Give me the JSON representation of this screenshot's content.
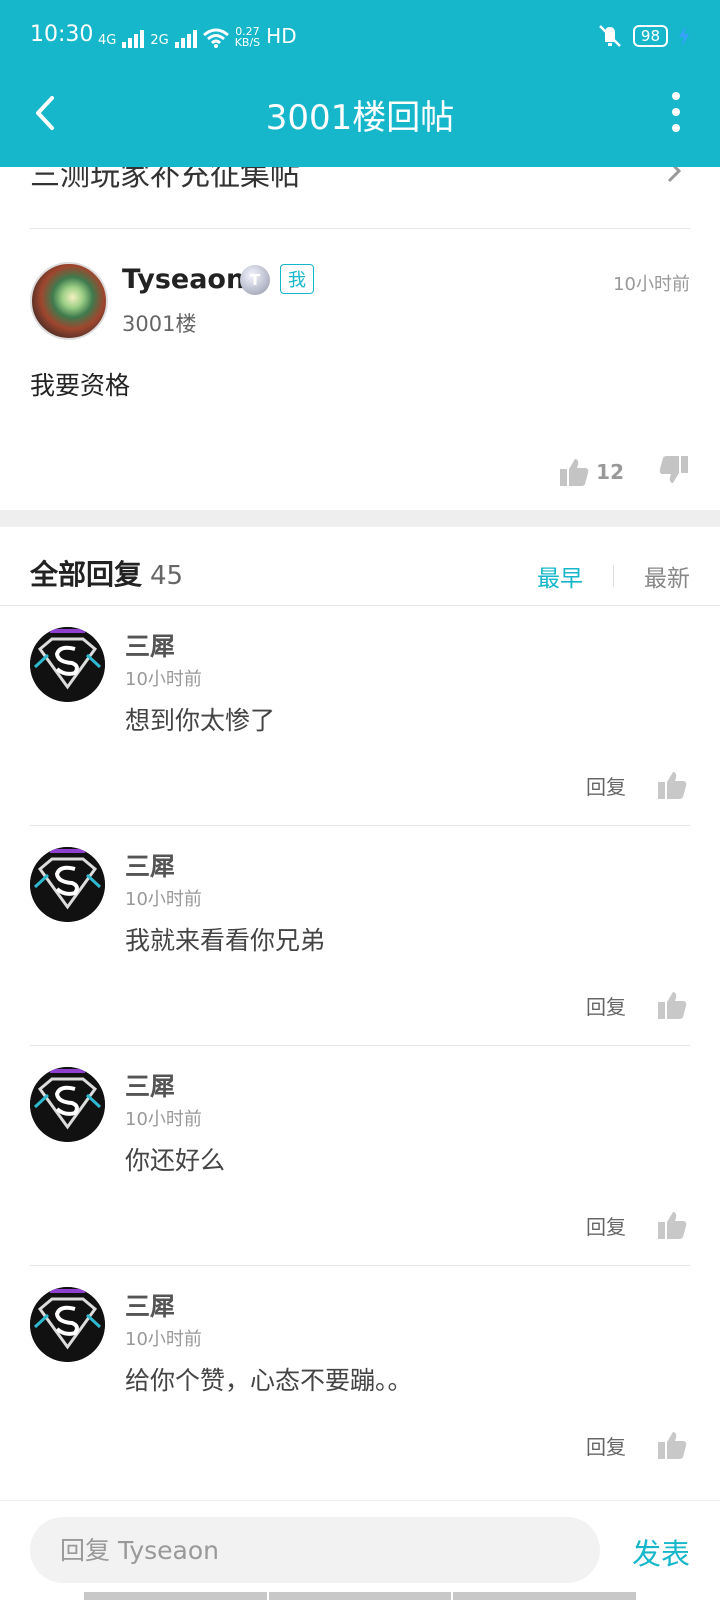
{
  "status": {
    "time": "10:30",
    "net1": "4G",
    "net2": "2G",
    "speed_top": "0.27",
    "speed_bottom": "KB/S",
    "hd": "HD",
    "battery": "98"
  },
  "nav": {
    "title": "3001楼回帖"
  },
  "thread": {
    "partial_title": "三测玩家补充征集帖"
  },
  "post": {
    "author": "Tyseaon",
    "level_badge": "T",
    "me_badge": "我",
    "floor": "3001楼",
    "time": "10小时前",
    "content": "我要资格",
    "likes": "12"
  },
  "replies_header": {
    "label": "全部回复",
    "count": "45",
    "sort_earliest": "最早",
    "sort_newest": "最新"
  },
  "replies": [
    {
      "name": "三犀",
      "time": "10小时前",
      "text": "想到你太惨了",
      "reply_label": "回复"
    },
    {
      "name": "三犀",
      "time": "10小时前",
      "text": "我就来看看你兄弟",
      "reply_label": "回复"
    },
    {
      "name": "三犀",
      "time": "10小时前",
      "text": "你还好么",
      "reply_label": "回复"
    },
    {
      "name": "三犀",
      "time": "10小时前",
      "text": "给你个赞，心态不要蹦。。",
      "reply_label": "回复"
    }
  ],
  "footer": {
    "placeholder": "回复 Tyseaon",
    "post_label": "发表"
  },
  "colors": {
    "accent": "#16b7cb"
  }
}
